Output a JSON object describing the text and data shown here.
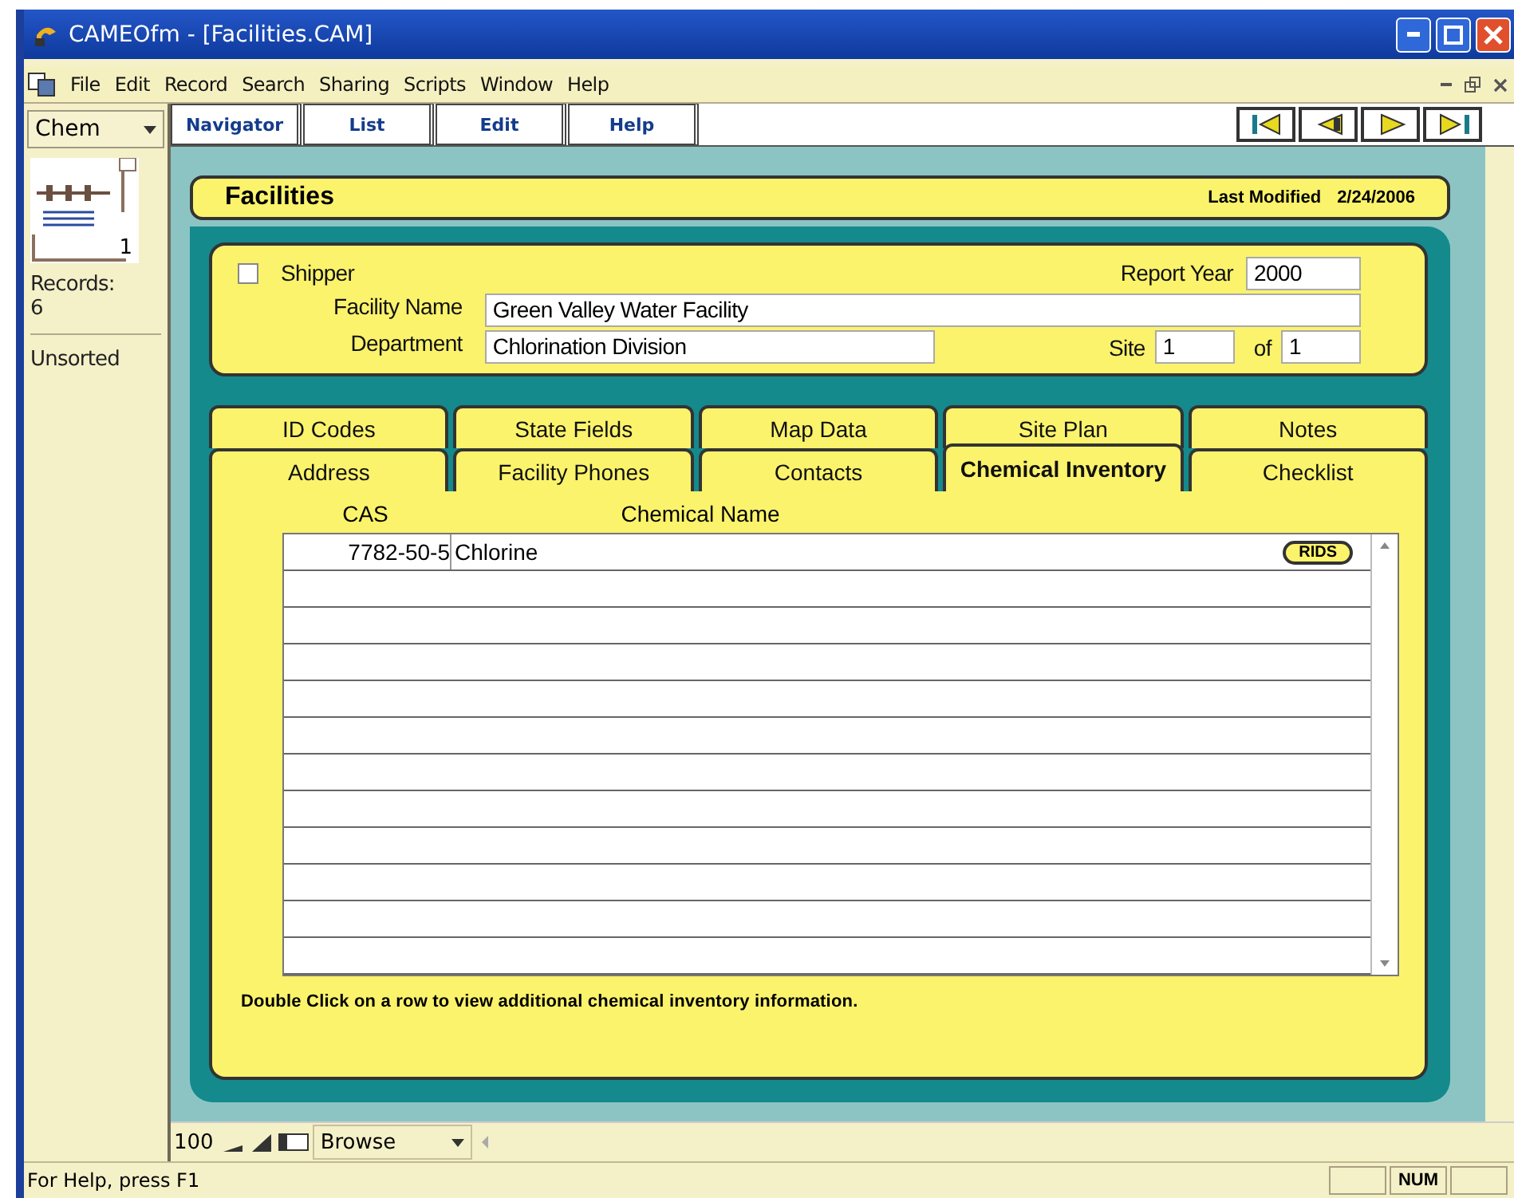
{
  "window": {
    "title": "CAMEOfm - [Facilities.CAM]"
  },
  "menu": [
    "File",
    "Edit",
    "Record",
    "Search",
    "Sharing",
    "Scripts",
    "Window",
    "Help"
  ],
  "toolbar": {
    "buttons": [
      "Navigator",
      "List",
      "Edit",
      "Help"
    ]
  },
  "sidebar": {
    "layout": "Chem",
    "record_number": "1",
    "records_label": "Records:",
    "records_count": "6",
    "sort_state": "Unsorted"
  },
  "header": {
    "title": "Facilities",
    "modified_label": "Last Modified",
    "modified_date": "2/24/2006"
  },
  "form": {
    "shipper": {
      "label": "Shipper",
      "checked": false
    },
    "report_year_label": "Report Year",
    "report_year": "2000",
    "facility_name_label": "Facility Name",
    "facility_name": "Green Valley Water Facility",
    "department_label": "Department",
    "department": "Chlorination Division",
    "site_label": "Site",
    "site": "1",
    "of_label": "of",
    "site_total": "1"
  },
  "tabs": {
    "back_row": [
      {
        "label": "ID Codes",
        "selected": false
      },
      {
        "label": "State Fields",
        "selected": false
      },
      {
        "label": "Map Data",
        "selected": false
      },
      {
        "label": "Site Plan",
        "selected": false
      },
      {
        "label": "Notes",
        "selected": false
      }
    ],
    "front_row": [
      {
        "label": "Address",
        "selected": false
      },
      {
        "label": "Facility Phones",
        "selected": false
      },
      {
        "label": "Contacts",
        "selected": false
      },
      {
        "label": "Chemical Inventory",
        "selected": true
      },
      {
        "label": "Checklist",
        "selected": false
      }
    ]
  },
  "table": {
    "columns": [
      "CAS",
      "Chemical Name"
    ],
    "rows": [
      {
        "cas": "7782-50-5",
        "name": "Chlorine",
        "button": "RIDS"
      }
    ]
  },
  "note": "Double Click on a row to view additional chemical inventory information.",
  "bottom_bar": {
    "zoom": "100",
    "mode": "Browse"
  },
  "status_bar": {
    "help": "For Help, press F1",
    "num": "NUM"
  }
}
